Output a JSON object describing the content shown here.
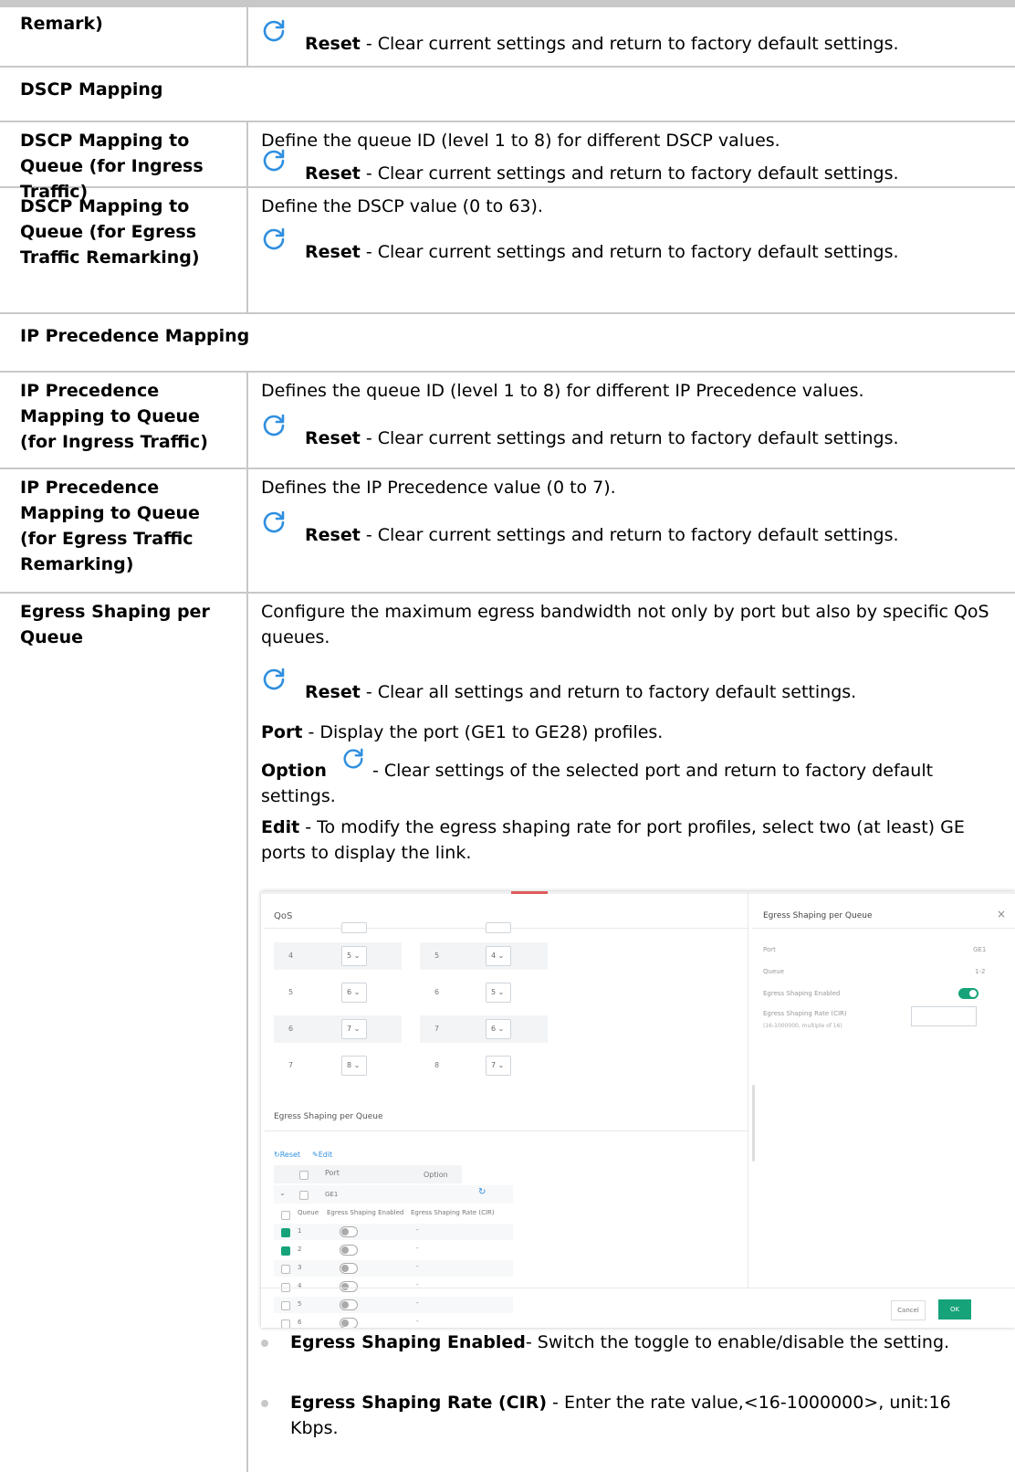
{
  "top_row": {
    "label": "Remark)",
    "reset_bold": "Reset",
    "reset_rest": " - Clear current settings and return to factory default settings."
  },
  "dscp_section": "DSCP Mapping",
  "dscp_ingress": {
    "label": "DSCP Mapping to Queue (for Ingress Traffic)",
    "desc": "Define the queue ID (level 1 to 8) for different DSCP values.",
    "reset_bold": "Reset",
    "reset_rest": " - Clear current settings and return to factory default settings."
  },
  "dscp_egress": {
    "label": "DSCP Mapping to Queue (for Egress Traffic Remarking)",
    "desc": "Define the DSCP value (0 to 63).",
    "reset_bold": "Reset",
    "reset_rest": " - Clear current settings and return to factory default settings."
  },
  "ipp_section": "IP Precedence Mapping",
  "ipp_ingress": {
    "label": "IP Precedence Mapping to Queue (for Ingress Traffic)",
    "desc": "Defines the queue ID (level 1 to 8) for different IP Precedence values.",
    "reset_bold": "Reset",
    "reset_rest": " - Clear current settings and return to factory default settings."
  },
  "ipp_egress": {
    "label": "IP Precedence Mapping to Queue (for Egress Traffic Remarking)",
    "desc": "Defines the IP Precedence value (0 to 7).",
    "reset_bold": "Reset",
    "reset_rest": " - Clear current settings and return to factory default settings."
  },
  "egress": {
    "label": "Egress Shaping per Queue",
    "desc": "Configure the maximum egress bandwidth not only by port but also by specific QoS queues.",
    "reset_bold": "Reset",
    "reset_rest": " - Clear all settings and return to factory default settings.",
    "port_bold": "Port",
    "port_rest": " - Display the port (GE1 to GE28) profiles.",
    "option_bold": "Option",
    "option_rest": " - Clear settings of the selected port and return to factory default settings.",
    "edit_bold": "Edit",
    "edit_rest": " - To modify the egress shaping rate for port profiles, select two (at least) GE ports to display the link.",
    "bullet1_bold": "Egress Shaping Enabled",
    "bullet1_rest": "- Switch the toggle to enable/disable the setting.",
    "bullet2_bold": "Egress Shaping Rate (CIR)",
    "bullet2_rest": " - Enter the rate value,<16-1000000>, unit:16 Kbps."
  },
  "screenshot": {
    "title": "QoS",
    "map_rows": [
      {
        "a": "4",
        "av": "5",
        "b": "5",
        "bv": "4"
      },
      {
        "a": "5",
        "av": "6",
        "b": "6",
        "bv": "5"
      },
      {
        "a": "6",
        "av": "7",
        "b": "7",
        "bv": "6"
      },
      {
        "a": "7",
        "av": "8",
        "b": "8",
        "bv": "7"
      }
    ],
    "section_title": "Egress Shaping per Queue",
    "reset": "Reset",
    "edit": "Edit",
    "col_port": "Port",
    "col_option": "Option",
    "port_name": "GE1",
    "col_queue": "Queue",
    "col_enabled": "Egress Shaping Enabled",
    "col_rate": "Egress Shaping Rate (CIR)",
    "queues": [
      "1",
      "2",
      "3",
      "4",
      "5",
      "6"
    ],
    "dash": "-",
    "panel_title": "Egress Shaping per Queue",
    "panel_port_label": "Port",
    "panel_port_value": "GE1",
    "panel_queue_label": "Queue",
    "panel_queue_value": "1-2",
    "panel_enabled_label": "Egress Shaping Enabled",
    "panel_rate_label": "Egress Shaping Rate (CIR)",
    "panel_rate_hint": "(16-1000000, multiple of 16)",
    "cancel": "Cancel",
    "ok": "OK"
  },
  "colors": {
    "accent": "#16a37a",
    "icon": "#2f8fe0",
    "border": "#c8c8c8"
  }
}
